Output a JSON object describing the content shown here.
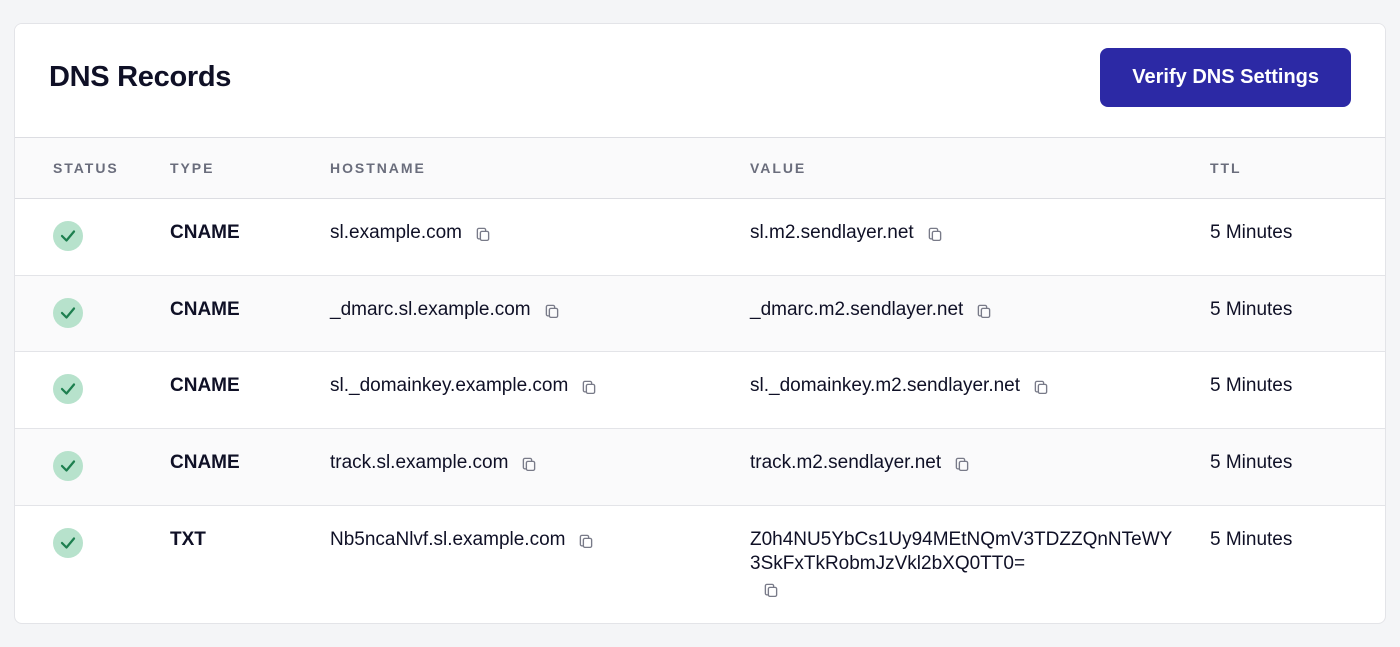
{
  "panel": {
    "title": "DNS Records",
    "verify_label": "Verify DNS Settings"
  },
  "table": {
    "headers": {
      "status": "STATUS",
      "type": "TYPE",
      "hostname": "HOSTNAME",
      "value": "VALUE",
      "ttl": "TTL"
    },
    "rows": [
      {
        "status": "verified",
        "type": "CNAME",
        "hostname": "sl.example.com",
        "value": "sl.m2.sendlayer.net",
        "ttl": "5 Minutes"
      },
      {
        "status": "verified",
        "type": "CNAME",
        "hostname": "_dmarc.sl.example.com",
        "value": "_dmarc.m2.sendlayer.net",
        "ttl": "5 Minutes"
      },
      {
        "status": "verified",
        "type": "CNAME",
        "hostname": "sl._domainkey.example.com",
        "value": "sl._domainkey.m2.sendlayer.net",
        "ttl": "5 Minutes"
      },
      {
        "status": "verified",
        "type": "CNAME",
        "hostname": "track.sl.example.com",
        "value": "track.m2.sendlayer.net",
        "ttl": "5 Minutes"
      },
      {
        "status": "verified",
        "type": "TXT",
        "hostname": "Nb5ncaNlvf.sl.example.com",
        "value": "Z0h4NU5YbCs1Uy94MEtNQmV3TDZZQnNTeWY3SkFxTkRobmJzVkl2bXQ0TT0=",
        "ttl": "5 Minutes"
      }
    ]
  },
  "icons": {
    "check": "check-icon",
    "copy": "copy-icon"
  },
  "colors": {
    "accent": "#2c29a5",
    "check_bg": "#b7e2cc",
    "check_mark": "#1d7f4f"
  }
}
